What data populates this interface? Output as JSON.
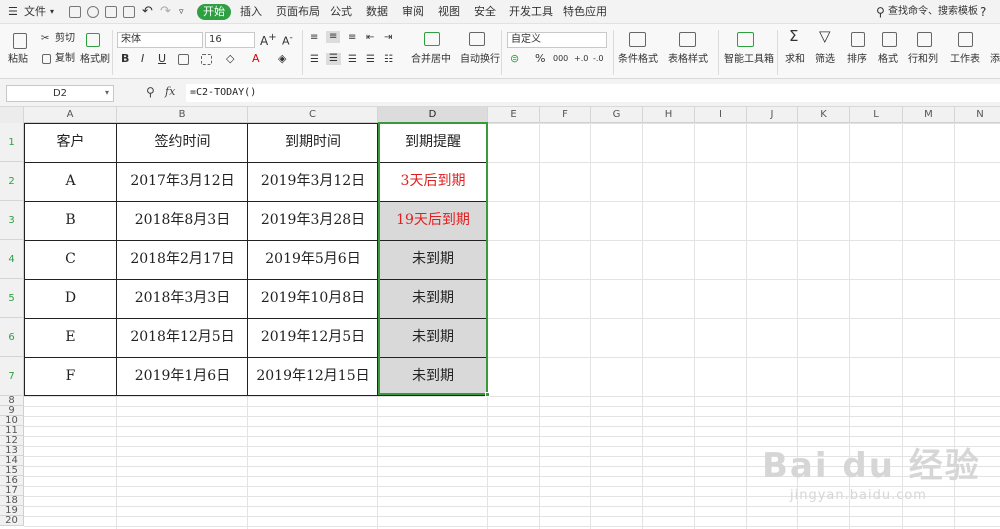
{
  "menubar": {
    "file_label": "文件",
    "tabs": [
      "开始",
      "插入",
      "页面布局",
      "公式",
      "数据",
      "审阅",
      "视图",
      "安全",
      "开发工具",
      "特色应用"
    ],
    "search_placeholder": "查找命令、搜索模板",
    "help": "?"
  },
  "ribbon": {
    "paste": "粘贴",
    "cut": "剪切",
    "copy": "复制",
    "format_painter": "格式刷",
    "font_name": "宋体",
    "font_size": "16",
    "merge_center": "合并居中",
    "wrap_text": "自动换行",
    "number_format": "自定义",
    "conditional_format": "条件格式",
    "table_style": "表格样式",
    "smart_toolbox": "智能工具箱",
    "sum": "求和",
    "filter": "筛选",
    "sort": "排序",
    "format": "格式",
    "rows_cols": "行和列",
    "worksheet": "工作表",
    "more": "添"
  },
  "formula_bar": {
    "name_box": "D2",
    "fx": "fx",
    "formula": "=C2-TODAY()"
  },
  "columns": [
    "A",
    "B",
    "C",
    "D",
    "E",
    "F",
    "G",
    "H",
    "I",
    "J",
    "K",
    "L",
    "M",
    "N"
  ],
  "rows": [
    "1",
    "2",
    "3",
    "4",
    "5",
    "6",
    "7",
    "8",
    "9",
    "10",
    "11",
    "12",
    "13",
    "14",
    "15",
    "16",
    "17",
    "18",
    "19",
    "20"
  ],
  "table": {
    "headers": [
      "客户",
      "签约时间",
      "到期时间",
      "到期提醒"
    ],
    "rows": [
      [
        "A",
        "2017年3月12日",
        "2019年3月12日",
        "3天后到期"
      ],
      [
        "B",
        "2018年8月3日",
        "2019年3月28日",
        "19天后到期"
      ],
      [
        "C",
        "2018年2月17日",
        "2019年5月6日",
        "未到期"
      ],
      [
        "D",
        "2018年3月3日",
        "2019年10月8日",
        "未到期"
      ],
      [
        "E",
        "2018年12月5日",
        "2019年12月5日",
        "未到期"
      ],
      [
        "F",
        "2019年1月6日",
        "2019年12月15日",
        "未到期"
      ]
    ]
  },
  "watermark": {
    "brand": "Bai du 经验",
    "url": "jingyan.baidu.com"
  },
  "colors": {
    "accent": "#2fa042",
    "alert_text": "#e02020",
    "selection": "#3a9a3a"
  }
}
